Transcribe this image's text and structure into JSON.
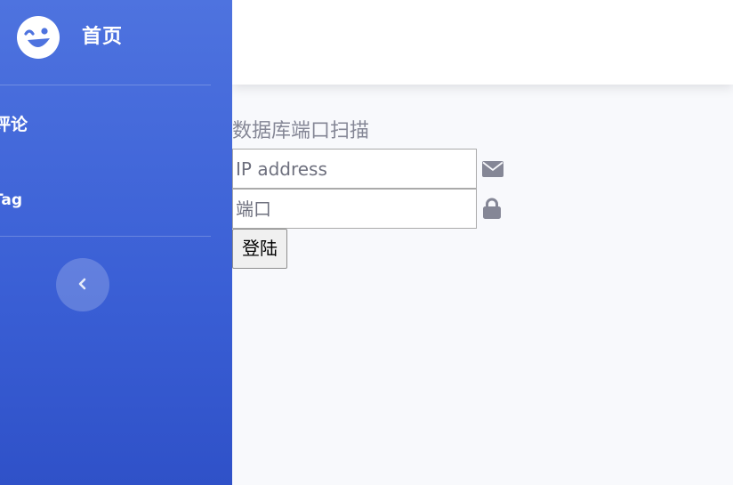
{
  "sidebar": {
    "brand": {
      "icon": "laugh-wink-icon",
      "label": "首页"
    },
    "items": [
      {
        "label": "评论"
      },
      {
        "label": "Tag"
      }
    ],
    "toggle": {
      "icon": "chevron-left-icon"
    }
  },
  "form": {
    "title": "数据库端口扫描",
    "ip": {
      "placeholder": "IP address",
      "value": "",
      "icon": "envelope-icon"
    },
    "port": {
      "placeholder": "端口",
      "value": "",
      "icon": "lock-icon"
    },
    "submit_label": "登陆"
  },
  "colors": {
    "sidebar_gradient_top": "#4e73df",
    "sidebar_gradient_bottom": "#2f51c8",
    "content_bg": "#f8f9fc",
    "muted_text": "#858796"
  }
}
